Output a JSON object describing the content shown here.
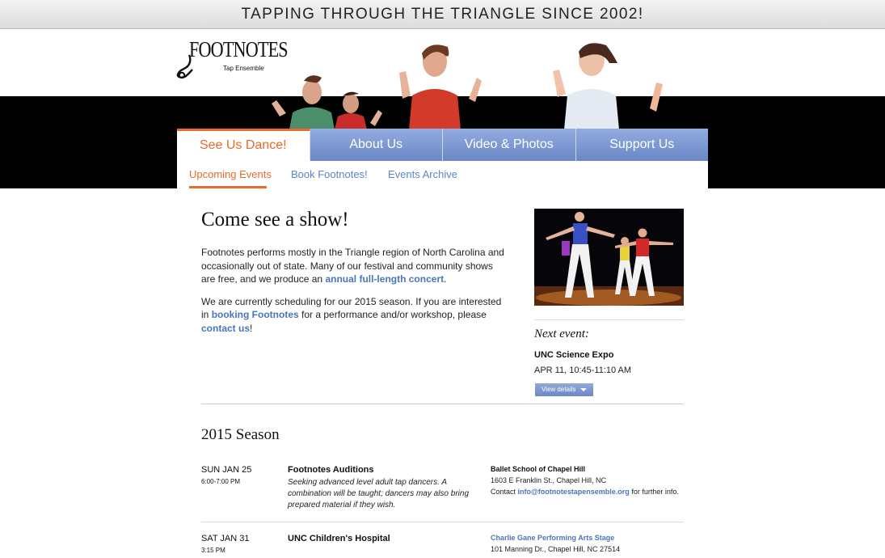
{
  "banner": {
    "text": "TAPPING THROUGH THE TRIANGLE SINCE 2002!"
  },
  "logo": {
    "word": "FOOTNOTES",
    "sub": "Tap Ensemble"
  },
  "nav": {
    "tabs": [
      "See Us Dance!",
      "About Us",
      "Video & Photos",
      "Support Us"
    ],
    "active": "See Us Dance!"
  },
  "subnav": {
    "items": [
      "Upcoming Events",
      "Book Footnotes!",
      "Events Archive"
    ],
    "active": "Upcoming Events"
  },
  "main": {
    "title": "Come see a show!",
    "p1_text": "Footnotes performs mostly in the Triangle region of North Carolina and occasionally out of state. Many of our festival and community shows are free, and we produce an ",
    "p1_link": "annual full-length concert",
    "p1_end": ".",
    "p2_text": "We are currently scheduling for our 2015 season. If you are interested in ",
    "p2_link1": "booking Footnotes",
    "p2_mid": " for a performance and/or workshop, please ",
    "p2_link2": "contact us",
    "p2_end": "!"
  },
  "sidebar": {
    "next_label": "Next event:",
    "next_title": "UNC Science Expo",
    "next_time": "APR 11, 10:45-11:10 AM",
    "view_details": "View details"
  },
  "season": {
    "title": "2015 Season",
    "events": [
      {
        "date": "SUN JAN 25",
        "time": "6:00-7:00 PM",
        "title": "Footnotes Auditions",
        "desc": "Seeking advanced level adult tap dancers. A combination will be taught; dancers may also bring prepared material if they wish.",
        "venue": "Ballet School of Chapel Hill",
        "address": "1603 E Franklin St., Chapel Hill, NC",
        "contact_pre": "Contact ",
        "contact_email": "info@footnotestapensemble.org",
        "contact_post": " for further info."
      },
      {
        "date": "SAT JAN 31",
        "time": "3:15 PM",
        "title": "UNC Children's Hospital",
        "venue": "Charlie Gane Performing Arts Stage",
        "address": "101 Manning Dr., Chapel Hill, NC 27514"
      }
    ]
  },
  "colors": {
    "accent": "#e8692c",
    "link": "#4a76b8",
    "nav": "#7a96d0"
  }
}
